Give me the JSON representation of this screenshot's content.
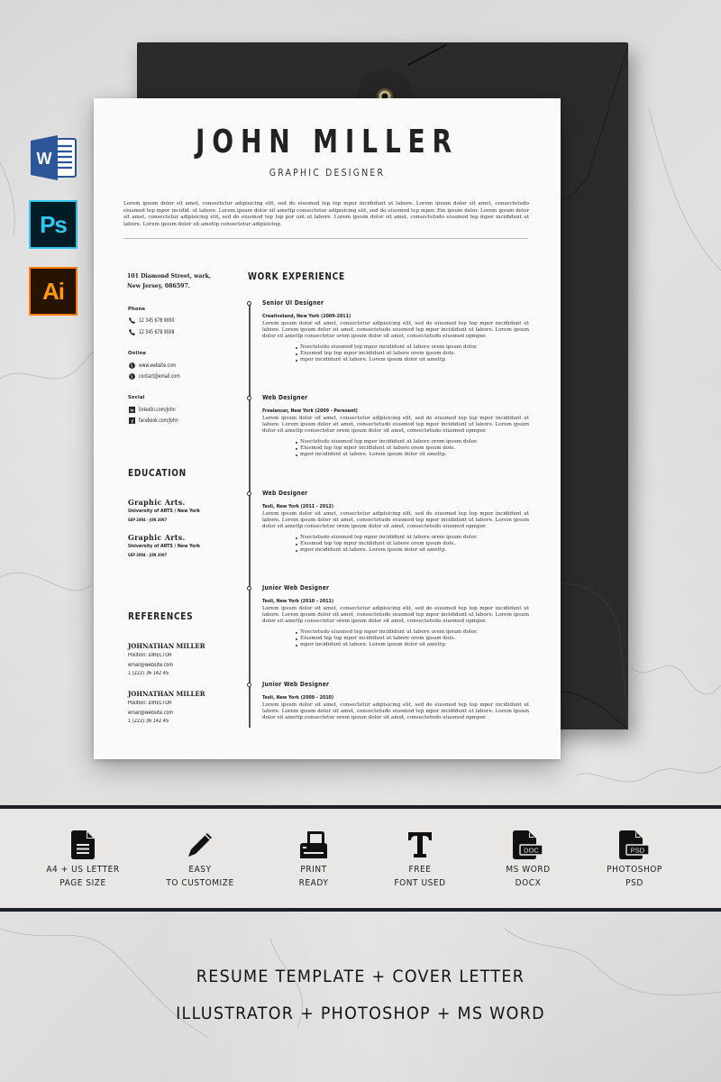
{
  "app_icons": [
    {
      "name": "ms-word",
      "label": "W"
    },
    {
      "name": "photoshop",
      "label": "Ps"
    },
    {
      "name": "illustrator",
      "label": "Ai"
    }
  ],
  "resume": {
    "name": "JOHN MILLER",
    "role": "GRAPHIC DESIGNER",
    "summary": "Lorem ipsum dolor sit amet, consectetur adipisicing elit, sed do eiusmod tep top mpor incididunt ut labore. Lorem ipsum dolor sit amet, consectetudo eiusmod tep mpor incidid. ut labore. Lorem ipsum dolor sit amettp consectetur adipisicing elit, sed do eiusmod tep mpor. Em ipsum dolor. Lorem ipsum dolor sit amet, consectetur adipisicing elit, sed do eiusmod tep top por unt ut labore. Lorem ipsum dolor sit amet, consectetudo eiusmod tep mpor incididunt ut labore. Lorem ipsum dolor sit amettp consectetur adipisicing.",
    "address_line1": "101 Diamond Street, wark,",
    "address_line2": "New Jersey, 086597.",
    "contact": {
      "phone_label": "Phone",
      "phones": [
        "12 345 678 9000",
        "12 345 678 9008"
      ],
      "online_label": "Online",
      "online": [
        "www.website.com",
        "contact@email.com"
      ],
      "social_label": "Social",
      "social": [
        "linkedin.com/John",
        "facebook.com/John"
      ]
    },
    "education": {
      "heading": "EDUCATION",
      "items": [
        {
          "title": "Graphic Arts.",
          "school": "University of ARTS / New York",
          "dates": "SEP 2004 - JUN 2007"
        },
        {
          "title": "Graphic Arts.",
          "school": "University of ARTS / New York",
          "dates": "SEP 2004 - JUN 2007"
        }
      ]
    },
    "references": {
      "heading": "REFERENCES",
      "items": [
        {
          "name": "JOHNATHAN MILLER",
          "position": "Position: DIRECTOR",
          "email": "email@website.com",
          "phone": "1 (222) 36 142 45"
        },
        {
          "name": "JOHNATHAN MILLER",
          "position": "Position: DIRECTOR",
          "email": "email@website.com",
          "phone": "1 (222) 36 142 45"
        }
      ]
    },
    "work": {
      "heading": "WORK EXPERIENCE",
      "jobs": [
        {
          "title": "Senior UI Designer",
          "company": "Creativeland, New York (2009-2011)",
          "description": "Lorem ipsum dolor sit amet, consectetur adipisicing elit, sed do eiusmod tep top mpor incididunt ut labore. Lorem ipsum dolor sit amet, consectetudo eiusmod tep mpor incididunt ut labore. Lorem ipsum dolor sit amettp consectetur orem ipsum dolor sit amet, consectetudo eiusmod opmpor.",
          "bullets": [
            "Nsectetudo eiusmod tep mpor incididunt ut labore orem ipsum dolor.",
            "Eiusmod tep top mpor incididunt ut labore orem ipsum dolo.",
            "mpor incididunt ut labore. Lorem ipsum dolor sit amettp."
          ]
        },
        {
          "title": "Web Designer",
          "company": "Freelancer, New York (2009 - Peresent)",
          "description": "Lorem ipsum dolor sit amet, consectetur adipisicing elit, sed do eiusmod tep top mpor incididunt ut labore. Lorem ipsum dolor sit amet, consectetudo eiusmod tep mpor incididunt ut labore. Lorem ipsum dolor sit amettp consectetur orem ipsum dolor sit amet, consectetudo eiusmod opmpor.",
          "bullets": [
            "Nsectetudo eiusmod tep mpor incididunt ut labore orem ipsum dolor.",
            "Eiusmod tep top mpor incididunt ut labore orem ipsum dolo.",
            "mpor incididunt ut labore. Lorem ipsum dolor sit amettp."
          ]
        },
        {
          "title": "Web Designer",
          "company": "Tesli, New York (2011 - 2012)",
          "description": "Lorem ipsum dolor sit amet, consectetur adipisicing elit, sed do eiusmod tep top mpor incididunt ut labore. Lorem ipsum dolor sit amet, consectetudo eiusmod tep mpor incididunt ut labore. Lorem ipsum dolor sit amettp consectetur orem ipsum dolor sit amet, consectetudo eiusmod opmpor.",
          "bullets": [
            "Nsectetudo eiusmod tep mpor incididunt ut labore orem ipsum dolor.",
            "Eiusmod tep top mpor incididunt ut labore orem ipsum dolo.",
            "mpor incididunt ut labore. Lorem ipsum dolor sit amettp."
          ]
        },
        {
          "title": "Junior Web Designer",
          "company": "Tesli, New York (2010 - 2011)",
          "description": "Lorem ipsum dolor sit amet, consectetur adipisicing elit, sed do eiusmod tep top mpor incididunt ut labore. Lorem ipsum dolor sit amet, consectetudo eiusmod tep mpor incididunt ut labore. Lorem ipsum dolor sit amettp consectetur orem ipsum dolor sit amet, consectetudo eiusmod opmpor.",
          "bullets": [
            "Nsectetudo eiusmod tep mpor incididunt ut labore orem ipsum dolor.",
            "Eiusmod tep top mpor incididunt ut labore orem ipsum dolo.",
            "mpor incididunt ut labore. Lorem ipsum dolor sit amettp."
          ]
        },
        {
          "title": "Junior Web Designer",
          "company": "Tesli, New York (2009 - 2010)",
          "description": "Lorem ipsum dolor sit amet, consectetur adipisicing elit, sed do eiusmod tep top mpor incididunt ut labore. Lorem ipsum dolor sit amet, consectetudo eiusmod tep mpor incididunt ut labore. Lorem ipsum dolor sit amettp consectetur orem ipsum dolor sit amet, consectetudo eiusmod opmpor.",
          "bullets": []
        }
      ]
    }
  },
  "features": [
    {
      "icon": "document-icon",
      "line1": "A4 + US LETTER",
      "line2": "PAGE SIZE"
    },
    {
      "icon": "pencil-icon",
      "line1": "EASY",
      "line2": "TO CUSTOMIZE"
    },
    {
      "icon": "printer-icon",
      "line1": "PRINT",
      "line2": "READY"
    },
    {
      "icon": "font-icon",
      "line1": "FREE",
      "line2": "FONT USED"
    },
    {
      "icon": "doc-file-icon",
      "line1": "MS WORD",
      "line2": "DOCX",
      "badge": "DOC"
    },
    {
      "icon": "psd-file-icon",
      "line1": "PHOTOSHOP",
      "line2": "PSD",
      "badge": "PSD"
    }
  ],
  "tagline": {
    "line1": "RESUME TEMPLATE + COVER LETTER",
    "line2": "ILLUSTRATOR + PHOTOSHOP + MS WORD"
  },
  "colors": {
    "band_border": "#1d2126",
    "band_bg": "#e8e7e6",
    "envelope": "#2b2b2b",
    "word_blue": "#2b579a",
    "ps_blue": "#31c5f0",
    "ai_orange": "#ff7c00"
  }
}
